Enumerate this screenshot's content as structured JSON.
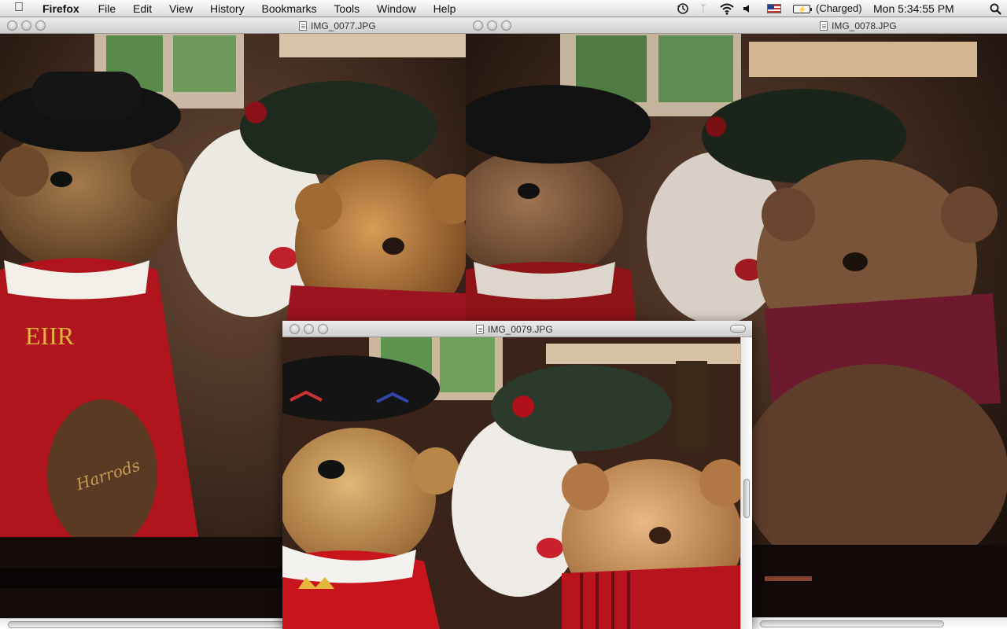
{
  "menubar": {
    "app": "Firefox",
    "items": [
      "File",
      "Edit",
      "View",
      "History",
      "Bookmarks",
      "Tools",
      "Window",
      "Help"
    ],
    "battery_status": "(Charged)",
    "clock": "Mon 5:34:55 PM",
    "icons": [
      "apple-icon",
      "time-machine-icon",
      "bluetooth-icon",
      "wifi-icon",
      "volume-icon",
      "us-flag-icon",
      "battery-icon",
      "spotlight-icon"
    ]
  },
  "windows": [
    {
      "title": "IMG_0077.JPG"
    },
    {
      "title": "IMG_0078.JPG"
    },
    {
      "title": "IMG_0079.JPG"
    }
  ],
  "photo_text": {
    "emblem": "EIIR",
    "paw": "Harrods"
  }
}
